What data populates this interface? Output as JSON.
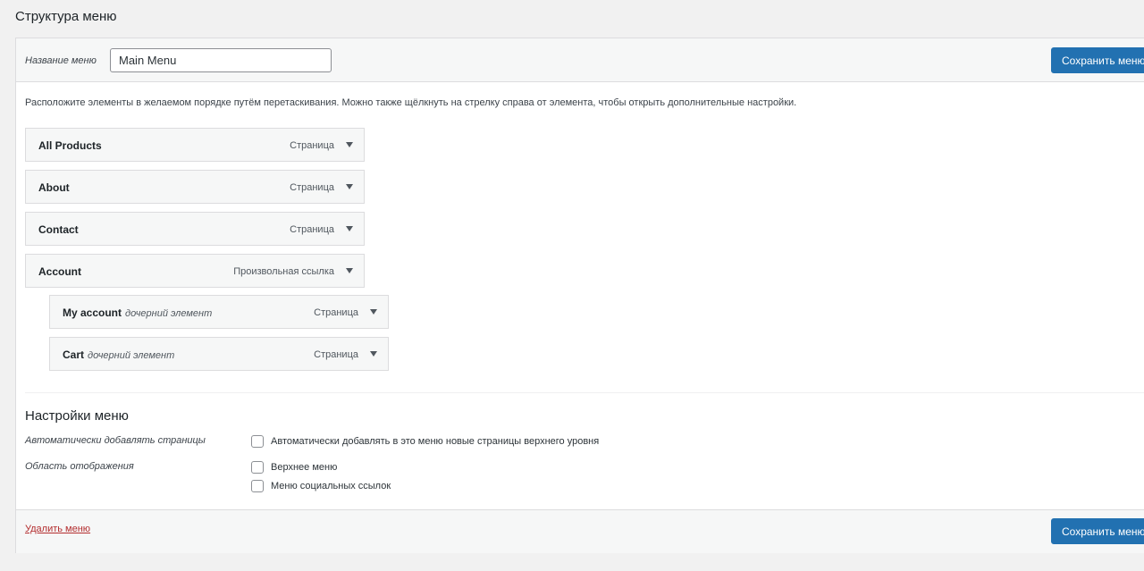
{
  "page": {
    "title": "Структура меню"
  },
  "header": {
    "menu_name_label": "Название меню",
    "menu_name_value": "Main Menu",
    "save_label": "Сохранить меню"
  },
  "instructions": "Расположите элементы в желаемом порядке путём перетаскивания. Можно также щёлкнуть на стрелку справа от элемента, чтобы открыть дополнительные настройки.",
  "menu_items": [
    {
      "title": "All Products",
      "subtitle": "",
      "type": "Страница",
      "depth": 0
    },
    {
      "title": "About",
      "subtitle": "",
      "type": "Страница",
      "depth": 0
    },
    {
      "title": "Contact",
      "subtitle": "",
      "type": "Страница",
      "depth": 0
    },
    {
      "title": "Account",
      "subtitle": "",
      "type": "Произвольная ссылка",
      "depth": 0
    },
    {
      "title": "My account",
      "subtitle": "дочерний элемент",
      "type": "Страница",
      "depth": 1
    },
    {
      "title": "Cart",
      "subtitle": "дочерний элемент",
      "type": "Страница",
      "depth": 1
    }
  ],
  "settings": {
    "title": "Настройки меню",
    "auto_add_label": "Автоматически добавлять страницы",
    "auto_add_option": "Автоматически добавлять в это меню новые страницы верхнего уровня",
    "display_location_label": "Область отображения",
    "locations": [
      "Верхнее меню",
      "Меню социальных ссылок"
    ]
  },
  "footer": {
    "delete_label": "Удалить меню",
    "save_label": "Сохранить меню"
  },
  "colors": {
    "accent": "#2271b1",
    "danger": "#b32d2e",
    "panel_bg": "#f6f7f7"
  }
}
